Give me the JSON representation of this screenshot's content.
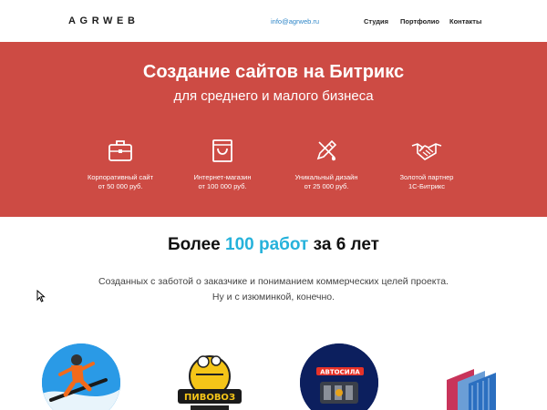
{
  "header": {
    "logo": "AGRWEB",
    "email": "info@agrweb.ru",
    "nav": [
      "Студия",
      "Портфолио",
      "Контакты"
    ]
  },
  "hero": {
    "title": "Создание сайтов на Битрикс",
    "subtitle": "для среднего и малого бизнеса",
    "features": [
      {
        "icon": "briefcase-icon",
        "line1": "Корпоративный сайт",
        "line2": "от 50 000 руб."
      },
      {
        "icon": "shopping-bag-icon",
        "line1": "Интернет-магазин",
        "line2": "от 100 000 руб."
      },
      {
        "icon": "pencil-brush-icon",
        "line1": "Уникальный дизайн",
        "line2": "от 25 000 руб."
      },
      {
        "icon": "handshake-icon",
        "line1": "Золотой партнер",
        "line2": "1С-Битрикс"
      }
    ]
  },
  "stats": {
    "prefix": "Более",
    "count": "100 работ",
    "middle": "за",
    "years": "6 лет",
    "line1": "Созданных с заботой о заказчике и пониманием коммерческих целей проекта.",
    "line2": "Ну и с изюминкой, конечно."
  },
  "portfolio": [
    {
      "icon": "snowboarder-image"
    },
    {
      "icon": "pivovoz-logo",
      "text": "ПИВОВОЗ"
    },
    {
      "icon": "avtosila-logo",
      "text": "АВТОСИЛА"
    },
    {
      "icon": "polycarbonate-sheets-image"
    }
  ],
  "colors": {
    "hero_bg": "#cd4b44",
    "accent": "#26b2db",
    "email_link": "#2e86c8"
  }
}
